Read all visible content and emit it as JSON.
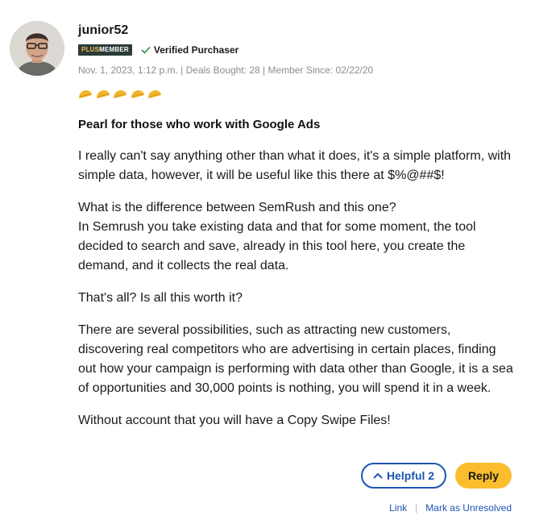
{
  "review": {
    "username": "junior52",
    "plus_badge": {
      "plus": "PLUS",
      "member": "MEMBER"
    },
    "verified_label": "Verified Purchaser",
    "meta": "Nov. 1, 2023, 1:12 p.m. | Deals Bought: 28 | Member Since: 02/22/20",
    "rating": 5,
    "rating_icon": "taco-icon",
    "title": "Pearl for those who work with Google Ads",
    "paragraphs": [
      "I really can't say anything other than what it does, it's a simple platform, with simple data, however, it will be useful like this there at $%@##$!",
      "What is the difference between SemRush and this one?\nIn Semrush you take existing data and that for some moment, the tool decided to search and save, already in this tool here, you create the demand, and it collects the real data.",
      "That's all? Is all this worth it?",
      "There are several possibilities, such as attracting new customers, discovering real competitors who are advertising in certain places, finding out how your campaign is performing with data other than Google, it is a sea of opportunities and 30,000 points is nothing, you will spend it in a week.",
      "Without account that you will have a Copy Swipe Files!"
    ]
  },
  "actions": {
    "helpful_label": "Helpful 2",
    "reply_label": "Reply",
    "link_label": "Link",
    "separator": "|",
    "mark_unresolved_label": "Mark as Unresolved"
  },
  "colors": {
    "accent_blue": "#1c55b3",
    "reply_yellow": "#fbbd2d",
    "badge_dark": "#2b3b38",
    "verified_green": "#2e8a4a",
    "taco": "#f2b529"
  }
}
